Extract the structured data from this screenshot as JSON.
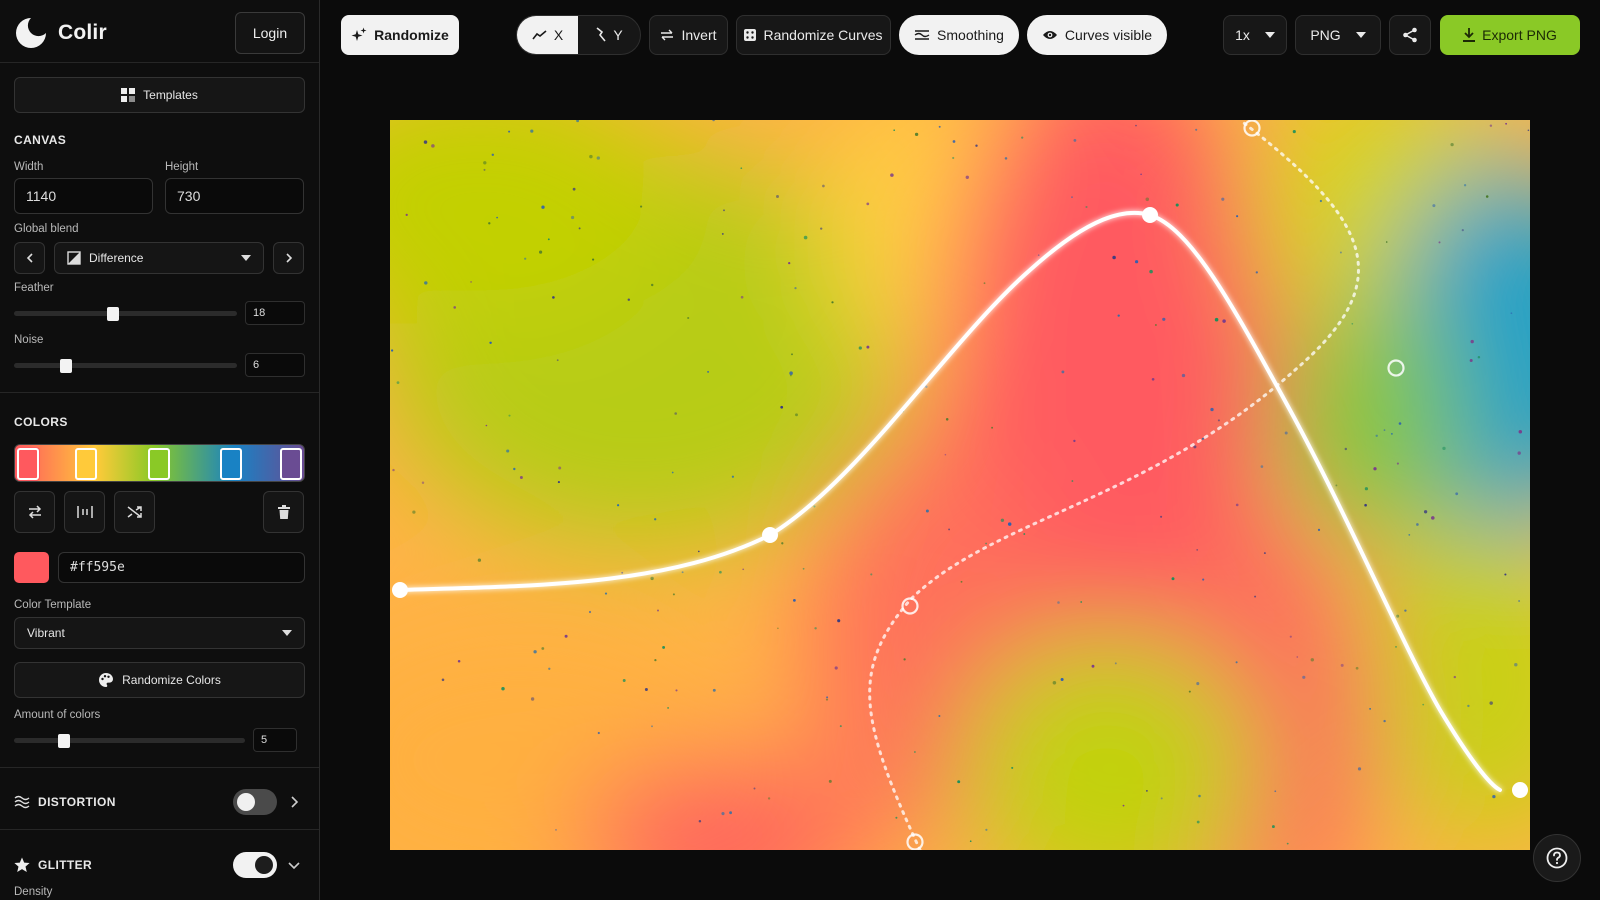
{
  "app": {
    "name": "Colir",
    "login_label": "Login"
  },
  "sidebar": {
    "templates_label": "Templates",
    "canvas": {
      "title": "CANVAS",
      "width_label": "Width",
      "width_value": "1140",
      "height_label": "Height",
      "height_value": "730",
      "blend_label": "Global blend",
      "blend_value": "Difference",
      "feather_label": "Feather",
      "feather_value": "18",
      "feather_fraction": 0.44,
      "noise_label": "Noise",
      "noise_value": "6",
      "noise_fraction": 0.22
    },
    "colors": {
      "title": "COLORS",
      "stops": [
        "#ff595e",
        "#ffca3a",
        "#8ac926",
        "#1982c4",
        "#6a4c93"
      ],
      "selected_hex": "#ff595e",
      "template_label": "Color Template",
      "template_value": "Vibrant",
      "randomize_label": "Randomize Colors",
      "amount_label": "Amount of colors",
      "amount_value": "5",
      "amount_fraction": 0.2
    },
    "distortion": {
      "label": "DISTORTION",
      "enabled": false
    },
    "glitter": {
      "label": "GLITTER",
      "enabled": true,
      "density_label": "Density"
    }
  },
  "toolbar": {
    "randomize_label": "Randomize",
    "x_label": "X",
    "y_label": "Y",
    "invert_label": "Invert",
    "randomize_curves_label": "Randomize Curves",
    "smoothing_label": "Smoothing",
    "curves_visible_label": "Curves visible",
    "scale_value": "1x",
    "format_value": "PNG",
    "export_label": "Export PNG"
  },
  "colors": {
    "accent": "#8ac926",
    "background": "#0b0b0b"
  },
  "icons": [
    "logo-icon",
    "templates-icon",
    "chevron-left-icon",
    "chevron-right-icon",
    "blend-icon",
    "swap-icon",
    "distribute-icon",
    "shuffle-icon",
    "trash-icon",
    "palette-icon",
    "waves-icon",
    "star-icon",
    "sparkle-icon",
    "trend-icon",
    "invert-icon",
    "dice-icon",
    "lines-icon",
    "eye-icon",
    "share-icon",
    "download-icon",
    "help-icon"
  ]
}
